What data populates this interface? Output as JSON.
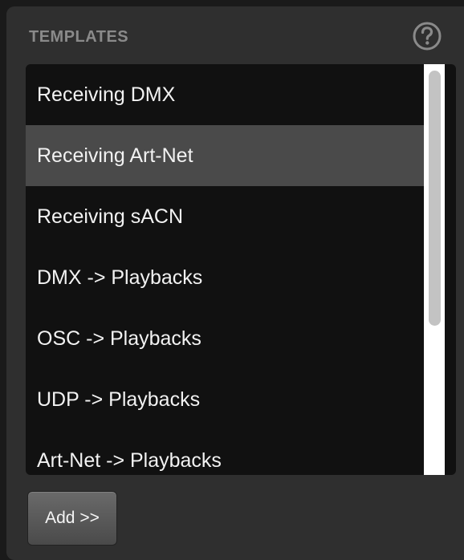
{
  "panel": {
    "title": "TEMPLATES",
    "help_icon": "question-circle-icon"
  },
  "templates": {
    "items": [
      {
        "label": "Receiving DMX",
        "selected": false
      },
      {
        "label": "Receiving Art-Net",
        "selected": true
      },
      {
        "label": "Receiving sACN",
        "selected": false
      },
      {
        "label": "DMX -> Playbacks",
        "selected": false
      },
      {
        "label": "OSC -> Playbacks",
        "selected": false
      },
      {
        "label": "UDP -> Playbacks",
        "selected": false
      },
      {
        "label": "Art-Net -> Playbacks",
        "selected": false
      }
    ]
  },
  "actions": {
    "add_label": "Add >>"
  },
  "colors": {
    "panel_bg": "#2f2f2f",
    "list_bg": "#111111",
    "selected_bg": "#4a4a4a",
    "title_text": "#8a8a8a",
    "item_text": "#f2f2f2"
  }
}
